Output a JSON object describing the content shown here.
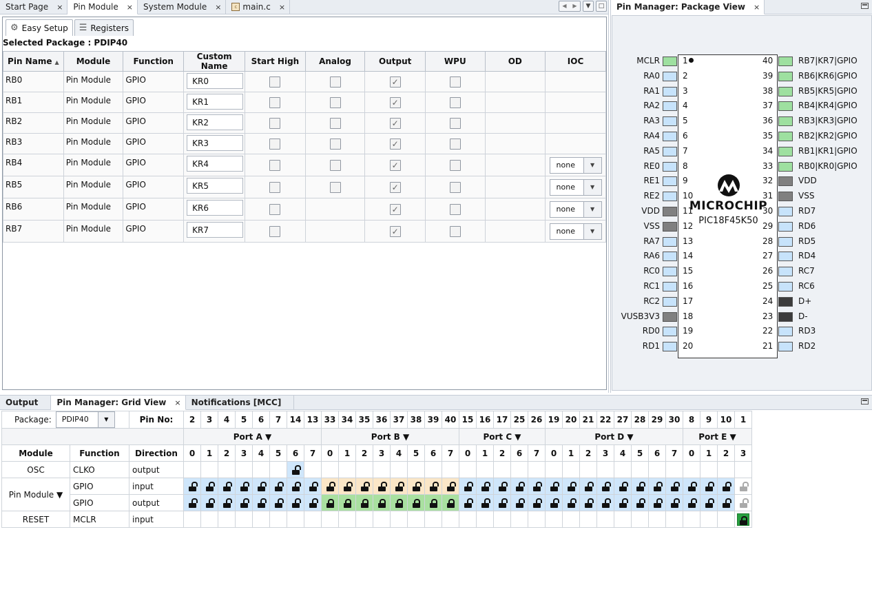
{
  "editor_tabs": [
    {
      "label": "Start Page",
      "close": "×"
    },
    {
      "label": "Pin Module",
      "close": "×"
    },
    {
      "label": "System Module",
      "close": "×"
    },
    {
      "label": "main.c",
      "close": "×"
    }
  ],
  "pin_module": {
    "subtabs": [
      "Easy Setup",
      "Registers"
    ],
    "selected_package": "Selected Package : PDIP40",
    "columns": [
      "Pin Name",
      "Module",
      "Function",
      "Custom Name",
      "Start High",
      "Analog",
      "Output",
      "WPU",
      "OD",
      "IOC"
    ],
    "rows": [
      {
        "pin": "RB0",
        "module": "Pin Module",
        "function": "GPIO",
        "custom": "KR0",
        "analog": true,
        "output": true,
        "ioc": null
      },
      {
        "pin": "RB1",
        "module": "Pin Module",
        "function": "GPIO",
        "custom": "KR1",
        "analog": true,
        "output": true,
        "ioc": null
      },
      {
        "pin": "RB2",
        "module": "Pin Module",
        "function": "GPIO",
        "custom": "KR2",
        "analog": true,
        "output": true,
        "ioc": null
      },
      {
        "pin": "RB3",
        "module": "Pin Module",
        "function": "GPIO",
        "custom": "KR3",
        "analog": true,
        "output": true,
        "ioc": null
      },
      {
        "pin": "RB4",
        "module": "Pin Module",
        "function": "GPIO",
        "custom": "KR4",
        "analog": true,
        "output": true,
        "ioc": "none"
      },
      {
        "pin": "RB5",
        "module": "Pin Module",
        "function": "GPIO",
        "custom": "KR5",
        "analog": true,
        "output": true,
        "ioc": "none"
      },
      {
        "pin": "RB6",
        "module": "Pin Module",
        "function": "GPIO",
        "custom": "KR6",
        "analog": false,
        "output": true,
        "ioc": "none"
      },
      {
        "pin": "RB7",
        "module": "Pin Module",
        "function": "GPIO",
        "custom": "KR7",
        "analog": false,
        "output": true,
        "ioc": "none"
      }
    ]
  },
  "package_view": {
    "title": "Pin Manager: Package View",
    "close": "×",
    "brand": "MICROCHIP",
    "part": "PIC18F45K50",
    "left_pins": [
      {
        "num": "1",
        "name": "MCLR",
        "color": "green"
      },
      {
        "num": "2",
        "name": "RA0",
        "color": "blue"
      },
      {
        "num": "3",
        "name": "RA1",
        "color": "blue"
      },
      {
        "num": "4",
        "name": "RA2",
        "color": "blue"
      },
      {
        "num": "5",
        "name": "RA3",
        "color": "blue"
      },
      {
        "num": "6",
        "name": "RA4",
        "color": "blue"
      },
      {
        "num": "7",
        "name": "RA5",
        "color": "blue"
      },
      {
        "num": "8",
        "name": "RE0",
        "color": "blue"
      },
      {
        "num": "9",
        "name": "RE1",
        "color": "blue"
      },
      {
        "num": "10",
        "name": "RE2",
        "color": "blue"
      },
      {
        "num": "11",
        "name": "VDD",
        "color": "grey"
      },
      {
        "num": "12",
        "name": "VSS",
        "color": "grey"
      },
      {
        "num": "13",
        "name": "RA7",
        "color": "blue"
      },
      {
        "num": "14",
        "name": "RA6",
        "color": "blue"
      },
      {
        "num": "15",
        "name": "RC0",
        "color": "blue"
      },
      {
        "num": "16",
        "name": "RC1",
        "color": "blue"
      },
      {
        "num": "17",
        "name": "RC2",
        "color": "blue"
      },
      {
        "num": "18",
        "name": "VUSB3V3",
        "color": "grey"
      },
      {
        "num": "19",
        "name": "RD0",
        "color": "blue"
      },
      {
        "num": "20",
        "name": "RD1",
        "color": "blue"
      }
    ],
    "right_pins": [
      {
        "num": "40",
        "name": "RB7|KR7|GPIO",
        "color": "green"
      },
      {
        "num": "39",
        "name": "RB6|KR6|GPIO",
        "color": "green"
      },
      {
        "num": "38",
        "name": "RB5|KR5|GPIO",
        "color": "green"
      },
      {
        "num": "37",
        "name": "RB4|KR4|GPIO",
        "color": "green"
      },
      {
        "num": "36",
        "name": "RB3|KR3|GPIO",
        "color": "green"
      },
      {
        "num": "35",
        "name": "RB2|KR2|GPIO",
        "color": "green"
      },
      {
        "num": "34",
        "name": "RB1|KR1|GPIO",
        "color": "green"
      },
      {
        "num": "33",
        "name": "RB0|KR0|GPIO",
        "color": "green"
      },
      {
        "num": "32",
        "name": "VDD",
        "color": "grey"
      },
      {
        "num": "31",
        "name": "VSS",
        "color": "grey"
      },
      {
        "num": "30",
        "name": "RD7",
        "color": "blue"
      },
      {
        "num": "29",
        "name": "RD6",
        "color": "blue"
      },
      {
        "num": "28",
        "name": "RD5",
        "color": "blue"
      },
      {
        "num": "27",
        "name": "RD4",
        "color": "blue"
      },
      {
        "num": "26",
        "name": "RC7",
        "color": "blue"
      },
      {
        "num": "25",
        "name": "RC6",
        "color": "blue"
      },
      {
        "num": "24",
        "name": "D+",
        "color": "dark"
      },
      {
        "num": "23",
        "name": "D-",
        "color": "dark"
      },
      {
        "num": "22",
        "name": "RD3",
        "color": "blue"
      },
      {
        "num": "21",
        "name": "RD2",
        "color": "blue"
      }
    ],
    "pin_colors": {
      "green": "#9ee0a0",
      "blue": "#c7e3fb",
      "grey": "#808080",
      "dark": "#3c3c3c"
    }
  },
  "bottom_tabs": [
    {
      "label": "Output",
      "close": ""
    },
    {
      "label": "Pin Manager: Grid View",
      "close": "×"
    },
    {
      "label": "Notifications [MCC]",
      "close": ""
    }
  ],
  "grid": {
    "package_label": "Package:",
    "package_value": "PDIP40",
    "pin_no_label": "Pin No:",
    "pin_numbers": [
      "2",
      "3",
      "4",
      "5",
      "6",
      "7",
      "14",
      "13",
      "33",
      "34",
      "35",
      "36",
      "37",
      "38",
      "39",
      "40",
      "15",
      "16",
      "17",
      "25",
      "26",
      "19",
      "20",
      "21",
      "22",
      "27",
      "28",
      "29",
      "30",
      "8",
      "9",
      "10",
      "1"
    ],
    "ports": [
      {
        "label": "Port A ▼",
        "span": 8
      },
      {
        "label": "Port B ▼",
        "span": 8
      },
      {
        "label": "Port C ▼",
        "span": 5
      },
      {
        "label": "Port D ▼",
        "span": 8
      },
      {
        "label": "Port E ▼",
        "span": 4
      }
    ],
    "col_headers": [
      "Module",
      "Function",
      "Direction"
    ],
    "bits": [
      "0",
      "1",
      "2",
      "3",
      "4",
      "5",
      "6",
      "7",
      "0",
      "1",
      "2",
      "3",
      "4",
      "5",
      "6",
      "7",
      "0",
      "1",
      "2",
      "6",
      "7",
      "0",
      "1",
      "2",
      "3",
      "4",
      "5",
      "6",
      "7",
      "0",
      "1",
      "2",
      "3"
    ],
    "rows": [
      {
        "module": "OSC",
        "function": "CLKO",
        "direction": "output"
      },
      {
        "module": "Pin Module ▼",
        "function": "GPIO",
        "direction": "input"
      },
      {
        "module": "",
        "function": "GPIO",
        "direction": "output"
      },
      {
        "module": "RESET",
        "function": "MCLR",
        "direction": "input"
      }
    ]
  }
}
